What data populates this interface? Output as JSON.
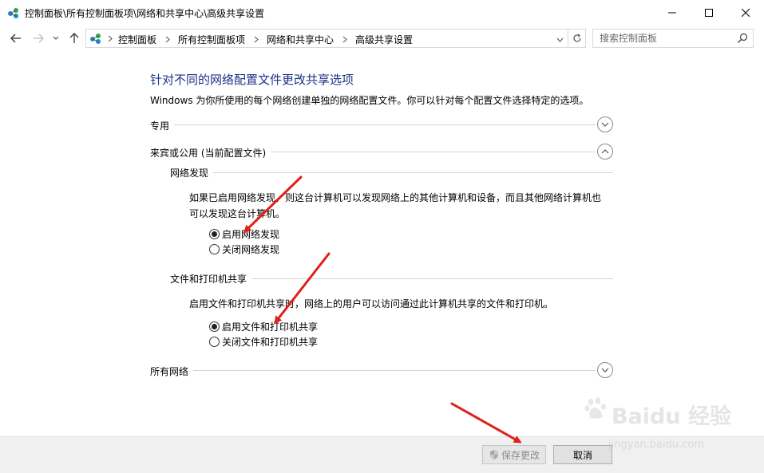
{
  "window": {
    "title": "控制面板\\所有控制面板项\\网络和共享中心\\高级共享设置"
  },
  "address": {
    "breadcrumbs": [
      "控制面板",
      "所有控制面板项",
      "网络和共享中心",
      "高级共享设置"
    ]
  },
  "search": {
    "placeholder": "搜索控制面板"
  },
  "main": {
    "heading": "针对不同的网络配置文件更改共享选项",
    "description": "Windows 为你所使用的每个网络创建单独的网络配置文件。你可以针对每个配置文件选择特定的选项。",
    "profiles": {
      "private": {
        "label": "专用",
        "expanded": false
      },
      "public": {
        "label": "来宾或公用 (当前配置文件)",
        "expanded": true
      },
      "all": {
        "label": "所有网络",
        "expanded": false
      }
    },
    "network_discovery": {
      "title": "网络发现",
      "description": "如果已启用网络发现，则这台计算机可以发现网络上的其他计算机和设备，而且其他网络计算机也可以发现这台计算机。",
      "options": [
        {
          "label": "启用网络发现",
          "selected": true
        },
        {
          "label": "关闭网络发现",
          "selected": false
        }
      ]
    },
    "file_printer_sharing": {
      "title": "文件和打印机共享",
      "description": "启用文件和打印机共享时，网络上的用户可以访问通过此计算机共享的文件和打印机。",
      "options": [
        {
          "label": "启用文件和打印机共享",
          "selected": true
        },
        {
          "label": "关闭文件和打印机共享",
          "selected": false
        }
      ]
    }
  },
  "footer": {
    "save_label": "保存更改",
    "cancel_label": "取消"
  },
  "watermark": {
    "brand": "Baidu 经验",
    "url": "jingyan.baidu.com"
  },
  "colors": {
    "heading": "#1e3287",
    "annotation_arrow": "#e0201b"
  }
}
